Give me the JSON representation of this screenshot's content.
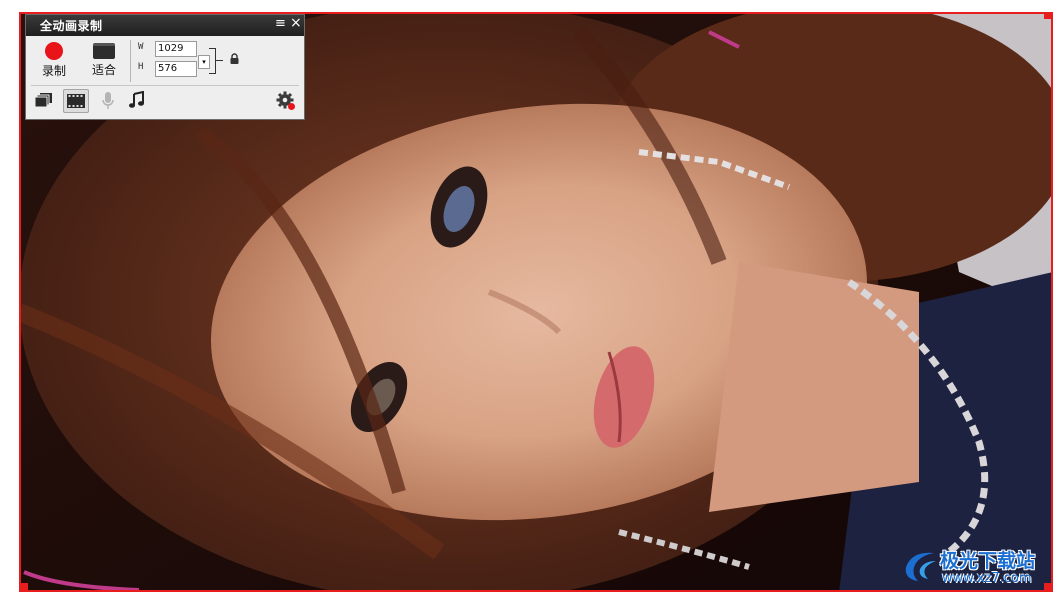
{
  "panel": {
    "title": "全动画录制",
    "menu_icon": "≡",
    "close_icon": "×",
    "record_label": "录制",
    "fit_label": "适合",
    "width_label": "W",
    "height_label": "H",
    "width_value": "1029",
    "height_value": "576",
    "dropdown_glyph": "▾"
  },
  "colors": {
    "record_frame": "#e81e1e",
    "record_dot": "#e8141a",
    "title_bar": "#2a2a2a",
    "panel_bg": "#eeeeee",
    "watermark": "#1c6fd1"
  },
  "icons": {
    "record": "record-icon",
    "fit": "fit-window-icon",
    "lock": "lock-icon",
    "windows": "windows-mode-icon",
    "video": "video-mode-icon",
    "microphone": "microphone-icon",
    "music": "music-icon",
    "settings": "settings-icon"
  },
  "watermark": {
    "name": "极光下载站",
    "url": "www.xz7.com"
  }
}
